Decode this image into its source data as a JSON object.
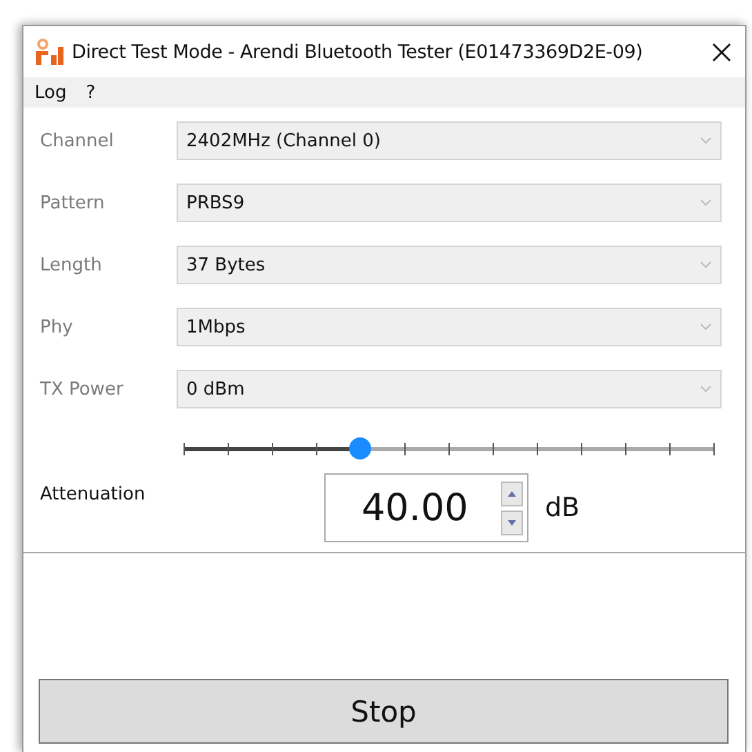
{
  "window": {
    "title": "Direct Test Mode - Arendi Bluetooth Tester (E01473369D2E-09)"
  },
  "menu": [
    "Log",
    "?"
  ],
  "fields": [
    {
      "label": "Channel",
      "value": "2402MHz (Channel 0)",
      "disabled": true
    },
    {
      "label": "Pattern",
      "value": "PRBS9",
      "disabled": true
    },
    {
      "label": "Length",
      "value": "37 Bytes",
      "disabled": true
    },
    {
      "label": "Phy",
      "value": "1Mbps",
      "disabled": true
    },
    {
      "label": "TX Power",
      "value": "0 dBm",
      "disabled": true
    }
  ],
  "attenuation": {
    "level": 0.333,
    "label": "Attenuation",
    "value": "40.00",
    "unit": "dB"
  },
  "buttons": [
    "Stop"
  ]
}
